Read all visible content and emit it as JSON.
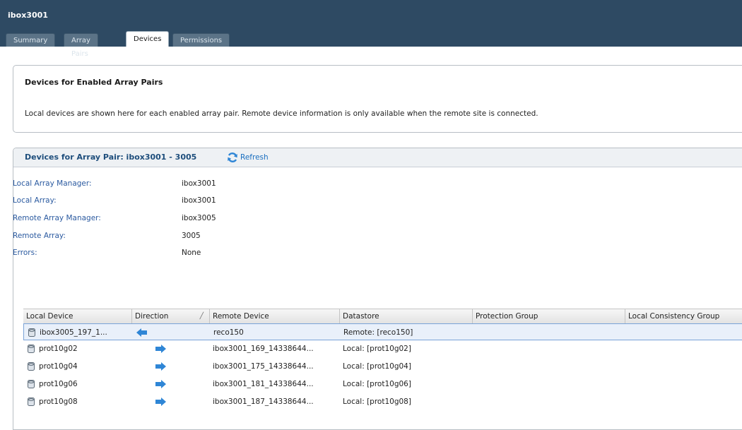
{
  "window": {
    "title": "ibox3001"
  },
  "tabs": [
    {
      "label": "Summary"
    },
    {
      "label": "Array Pairs"
    },
    {
      "label": "Devices"
    },
    {
      "label": "Permissions"
    }
  ],
  "active_tab": "Devices",
  "section1": {
    "heading": "Devices for Enabled Array Pairs",
    "description": "Local devices are shown here for each enabled array pair. Remote device information is only available when the remote site is connected."
  },
  "section2": {
    "heading": "Devices for Array Pair: ibox3001 - 3005",
    "refresh_label": "Refresh",
    "details": [
      {
        "label": "Local Array Manager:",
        "value": "ibox3001"
      },
      {
        "label": "Local Array:",
        "value": "ibox3001"
      },
      {
        "label": "Remote Array Manager:",
        "value": "ibox3005"
      },
      {
        "label": "Remote Array:",
        "value": "3005"
      },
      {
        "label": "Errors:",
        "value": "None"
      }
    ]
  },
  "table": {
    "columns": [
      "Local Device",
      "Direction",
      "Remote Device",
      "Datastore",
      "Protection Group",
      "Local Consistency Group"
    ],
    "sort_column": "Direction",
    "rows": [
      {
        "local_device": "ibox3005_197_1...",
        "direction": "incoming",
        "remote_device": "reco150",
        "datastore": "Remote: [reco150]",
        "protection_group": "",
        "consistency_group": "",
        "selected": true
      },
      {
        "local_device": "prot10g02",
        "direction": "outgoing",
        "remote_device": "ibox3001_169_14338644...",
        "datastore": "Local: [prot10g02]",
        "protection_group": "",
        "consistency_group": "",
        "selected": false
      },
      {
        "local_device": "prot10g04",
        "direction": "outgoing",
        "remote_device": "ibox3001_175_14338644...",
        "datastore": "Local: [prot10g04]",
        "protection_group": "",
        "consistency_group": "",
        "selected": false
      },
      {
        "local_device": "prot10g06",
        "direction": "outgoing",
        "remote_device": "ibox3001_181_14338644...",
        "datastore": "Local: [prot10g06]",
        "protection_group": "",
        "consistency_group": "",
        "selected": false
      },
      {
        "local_device": "prot10g08",
        "direction": "outgoing",
        "remote_device": "ibox3001_187_14338644...",
        "datastore": "Local: [prot10g08]",
        "protection_group": "",
        "consistency_group": "",
        "selected": false
      }
    ]
  },
  "icons": {
    "refresh": "refresh-icon",
    "device": "disk-icon",
    "incoming": "arrow-left-icon",
    "outgoing": "arrow-right-icon"
  },
  "colors": {
    "titlebar": "#2e4a63",
    "link": "#1a6fc0",
    "label": "#2b5aa0",
    "arrow": "#2f86d6",
    "selected_row": "#e9f0fa"
  }
}
